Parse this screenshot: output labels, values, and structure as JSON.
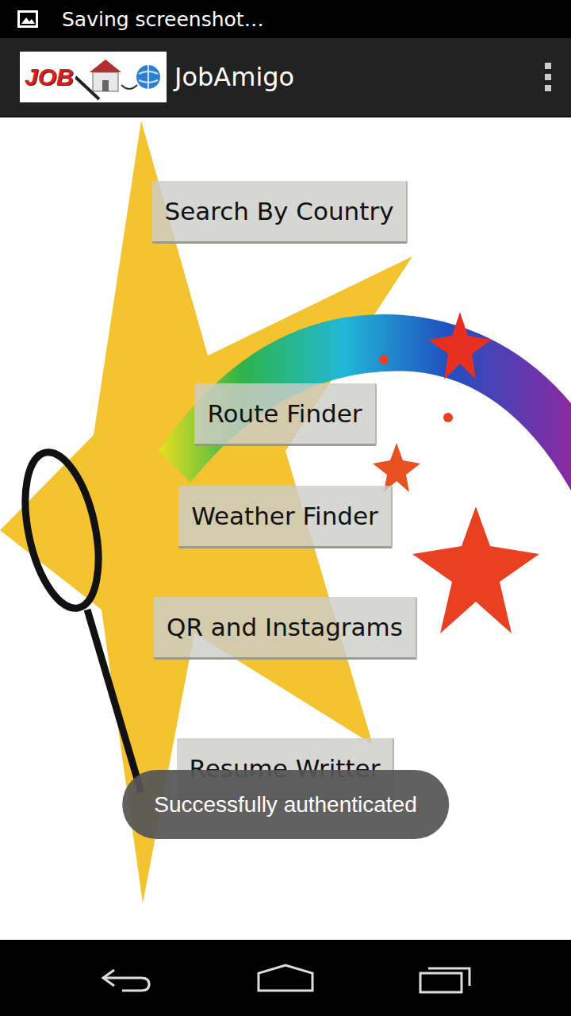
{
  "status_bar": {
    "notification": "Saving screenshot…"
  },
  "action_bar": {
    "logo": "JOB",
    "title": "JobAmigo"
  },
  "buttons": [
    "Search By Country",
    "Route Finder",
    "Weather Finder",
    "QR and Instagrams",
    "Resume Writter"
  ],
  "toast": {
    "message": "Successfully authenticated"
  }
}
